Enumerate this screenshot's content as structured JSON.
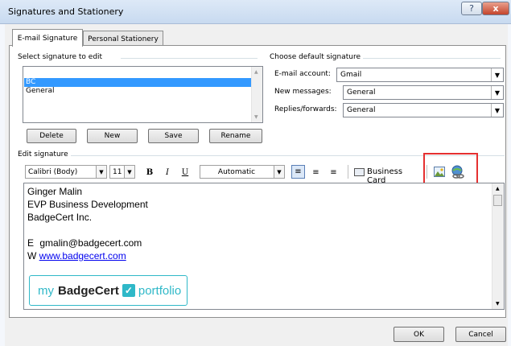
{
  "window": {
    "title": "Signatures and Stationery",
    "help": "?",
    "close": "x"
  },
  "tabs": {
    "email_signature": "E-mail Signature",
    "personal_stationery": "Personal Stationery"
  },
  "select_section": {
    "label": "Select signature to edit",
    "items": [
      "BC",
      "General"
    ],
    "selected_index": 0
  },
  "buttons": {
    "delete": "Delete",
    "new": "New",
    "save": "Save",
    "rename": "Rename",
    "ok": "OK",
    "cancel": "Cancel"
  },
  "default_section": {
    "label": "Choose default signature",
    "account_label": "E-mail account:",
    "account_value": "Gmail",
    "new_messages_label": "New messages:",
    "new_messages_value": "General",
    "replies_label": "Replies/forwards:",
    "replies_value": "General"
  },
  "edit_section": {
    "label": "Edit signature",
    "font": "Calibri (Body)",
    "size": "11",
    "bold": "B",
    "italic": "I",
    "underline": "U",
    "color": "Automatic",
    "business_card": "Business Card"
  },
  "signature": {
    "name": "Ginger Malin",
    "title": "EVP Business Development",
    "company": "BadgeCert Inc.",
    "email_prefix": "E",
    "email": "gmalin@badgecert.com",
    "web_prefix": "W",
    "web": "www.badgecert.com",
    "badge_my": "my",
    "badge_brand": "BadgeCert",
    "badge_portfolio": "portfolio"
  },
  "colors": {
    "highlight": "#e53030",
    "selection": "#3399ff",
    "badge_teal": "#2fb8c8"
  },
  "icons": [
    "insert-picture-icon",
    "hyperlink-icon"
  ]
}
